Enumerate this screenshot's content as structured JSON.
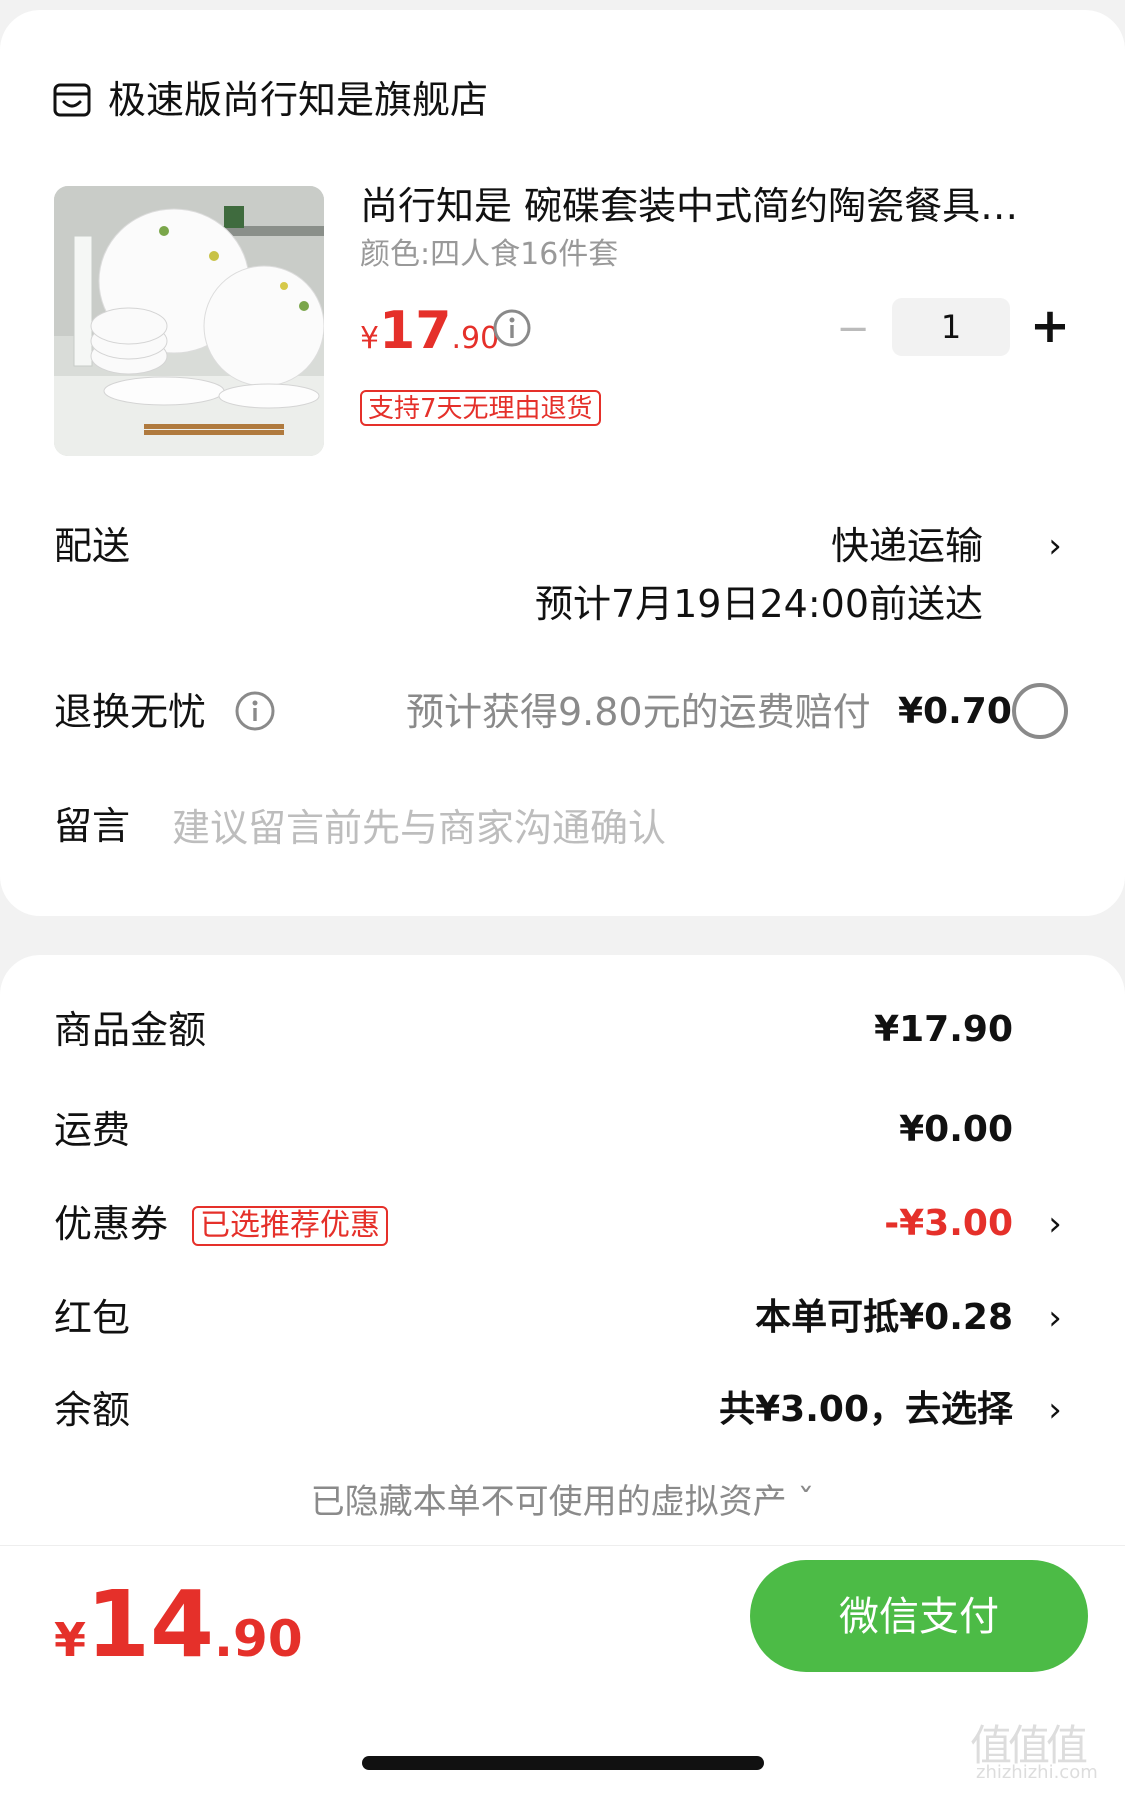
{
  "store": {
    "icon": "store-icon",
    "name": "极速版尚行知是旗舰店"
  },
  "product": {
    "thumbnail": "dinnerware-set-image",
    "title": "尚行知是  碗碟套装中式简约陶瓷餐具…",
    "spec": "颜色:四人食16件套",
    "price": {
      "currency": "¥",
      "integer": "17",
      "decimal": ".90"
    },
    "quantity": "1",
    "minus": "−",
    "plus": "+",
    "return_tag": "支持7天无理由退货"
  },
  "delivery": {
    "label": "配送",
    "method": "快递运输",
    "eta": "预计7月19日24:00前送达"
  },
  "worry_free_return": {
    "label": "退换无忧",
    "desc": "预计获得9.80元的运费赔付",
    "price": "¥0.70",
    "selected": false
  },
  "message": {
    "label": "留言",
    "placeholder": "建议留言前先与商家沟通确认",
    "value": ""
  },
  "summary": {
    "goods": {
      "label": "商品金额",
      "value": "¥17.90"
    },
    "shipping": {
      "label": "运费",
      "value": "¥0.00"
    },
    "coupon": {
      "label": "优惠券",
      "tag": "已选推荐优惠",
      "value": "-¥3.00"
    },
    "red_packet": {
      "label": "红包",
      "value": "本单可抵¥0.28"
    },
    "balance": {
      "label": "余额",
      "value": "共¥3.00，去选择"
    },
    "hidden_assets": "已隐藏本单不可使用的虚拟资产 ˇ"
  },
  "footer": {
    "total": {
      "currency": "¥",
      "integer": "14",
      "decimal": ".90"
    },
    "pay_button": "微信支付"
  },
  "chevron": "›",
  "watermark": {
    "main": "值值值",
    "sub": "zhizhizhi.com"
  },
  "colors": {
    "accent_red": "#e5302a",
    "pay_green": "#4cbb46",
    "muted_gray": "#8a8a8a"
  }
}
